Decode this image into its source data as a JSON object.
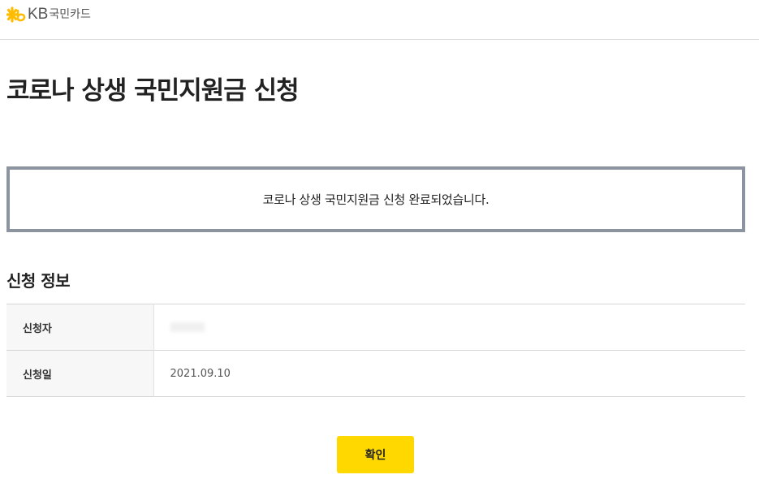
{
  "header": {
    "logo_kb": "KB",
    "logo_name": "국민카드",
    "logo_color": "#ffbc00"
  },
  "page_title": "코로나 상생 국민지원금 신청",
  "message": "코로나 상생 국민지원금 신청 완료되었습니다.",
  "section_title": "신청 정보",
  "info_rows": [
    {
      "label": "신청자",
      "value": ""
    },
    {
      "label": "신청일",
      "value": "2021.09.10"
    }
  ],
  "confirm_button": {
    "label": "확인",
    "color": "#ffd800"
  }
}
